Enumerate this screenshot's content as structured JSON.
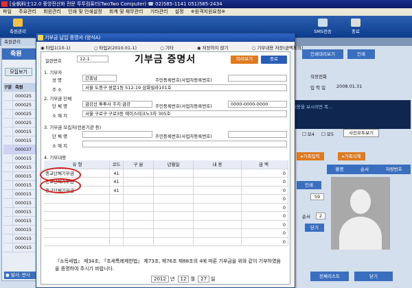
{
  "window_title": "[全帆科士12.0 중앙전산화 전문 투투컴퓨터(TwoTwo Computer) ☎ 02)585-1141  051)585-2434",
  "menu": [
    "파일",
    "주요관리",
    "회원관리",
    "인쇄 및 인쇄설정",
    "회계 및 재무관리",
    "기타관리",
    "설정",
    "※원격지원요청※"
  ],
  "toolbar": {
    "left_btn": "축원관리",
    "sms_btn": "SMS전송",
    "exit_btn": "종료"
  },
  "tab": {
    "label": "축원관리"
  },
  "left": {
    "header": "축원",
    "list_btn": "모집보기",
    "col1": "구분",
    "col2": "축원",
    "rows": [
      "000025",
      "000025",
      "000025",
      "000025",
      "000015",
      "000015",
      "000037",
      "000015",
      "000015",
      "000015",
      "000015",
      "000015",
      "000015",
      "000015",
      "000015",
      "000015",
      "000015",
      "000015"
    ],
    "bottom": "● 발사, 번사"
  },
  "right": {
    "print_btn": "인쇄대리보기",
    "print2_btn": "인쇄",
    "label1": "직장전화",
    "label2": "입 력 일",
    "date": "2008.01.31",
    "dark_text": "내용을 보시려면 폭...",
    "chk1": "모4",
    "chk2": "모5",
    "photo_btn": "사진모두보기",
    "add_btn": "▸가족입력",
    "del_btn": "▸가족삭제",
    "col_rel": "불명",
    "col_seq": "순서",
    "col_rec": "차량번호",
    "print3": "인쇄",
    "qty": "59",
    "seq_lbl": "순서",
    "seq": "2",
    "close": "닫기",
    "bottom_btn": "전체리스트",
    "bottom_btn2": "닫기"
  },
  "dialog": {
    "title": "기부금 납입 증명서 (양식A)",
    "radio1": "타입1(10-1)",
    "radio2": "타입2(2010.01-1)",
    "radio3": "기타",
    "radio4": "저장하지 않기",
    "radio5": "기부내용 저장(금액제외)",
    "serial_lbl": "일련번호",
    "serial": "12-1",
    "doc_title": "기부금 증명서",
    "preview_btn": "미리보기",
    "close_btn": "종료",
    "sec1": "1. 기부자",
    "name_lbl": "성 명",
    "name": "간홍남",
    "rrn_lbl": "주민등록번호(사업자등록번호)",
    "addr_lbl": "주 소",
    "addr": "서울 도봉구 쌍문1동 512-19 삼화빌라101호",
    "sec2": "2. 기부금 단체",
    "org_lbl": "단 체 명",
    "org": "금강산 투투사   주지:금강",
    "org_rrn": "0000-0000-0000",
    "org_addr_lbl": "소 재 지",
    "org_addr": "서울 구로구 구로3동 에이스테크노3차 305호",
    "sec3": "3. 기부금 모집처(언론기관 등)",
    "col_org": "단 체 명",
    "col_loc": "소 재 지",
    "sec4": "4. 기부내용",
    "grid_headers": [
      "유 형",
      "코드",
      "구 분",
      "년월일",
      "내 용",
      "금 액"
    ],
    "grid_rows": [
      {
        "type": "종교단체기부금",
        "code": "41",
        "amount": "0"
      },
      {
        "type": "종교단체기부금",
        "code": "41",
        "amount": "0"
      },
      {
        "type": "종교단체기부금",
        "code": "41",
        "amount": "0"
      },
      {
        "type": "",
        "code": "",
        "amount": "0"
      },
      {
        "type": "",
        "code": "",
        "amount": "0"
      },
      {
        "type": "",
        "code": "",
        "amount": "0"
      },
      {
        "type": "",
        "code": "",
        "amount": "0"
      },
      {
        "type": "",
        "code": "",
        "amount": "0"
      },
      {
        "type": "",
        "code": "",
        "amount": "0"
      }
    ],
    "note": "『소득세법』 제34조, 『조세특례제한법』 제73조, 제76조 제88조의 4에 따른 기부금을 위와 같이 기부하였음을 증명하여 주시기 바랍니다.",
    "year": "2012",
    "year_lbl": "년",
    "month": "12",
    "month_lbl": "월",
    "day": "27",
    "day_lbl": "일"
  },
  "colors": {
    "accent": "#2a5db8",
    "highlight": "#d21c1c",
    "orange": "#e07a1e"
  }
}
